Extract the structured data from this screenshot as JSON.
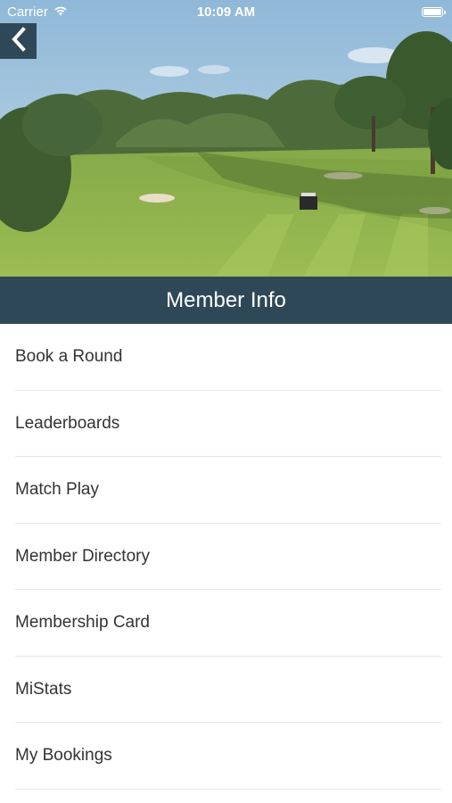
{
  "status_bar": {
    "carrier": "Carrier",
    "time": "10:09 AM"
  },
  "header": {
    "title": "Member Info",
    "back_icon": "chevron-left-icon"
  },
  "menu": {
    "items": [
      {
        "label": "Book a Round"
      },
      {
        "label": "Leaderboards"
      },
      {
        "label": "Match Play"
      },
      {
        "label": "Member Directory"
      },
      {
        "label": "Membership Card"
      },
      {
        "label": "MiStats"
      },
      {
        "label": "My Bookings"
      }
    ]
  },
  "colors": {
    "header_bg": "#2f4858",
    "text": "#333333",
    "divider": "#e6e6e6"
  }
}
